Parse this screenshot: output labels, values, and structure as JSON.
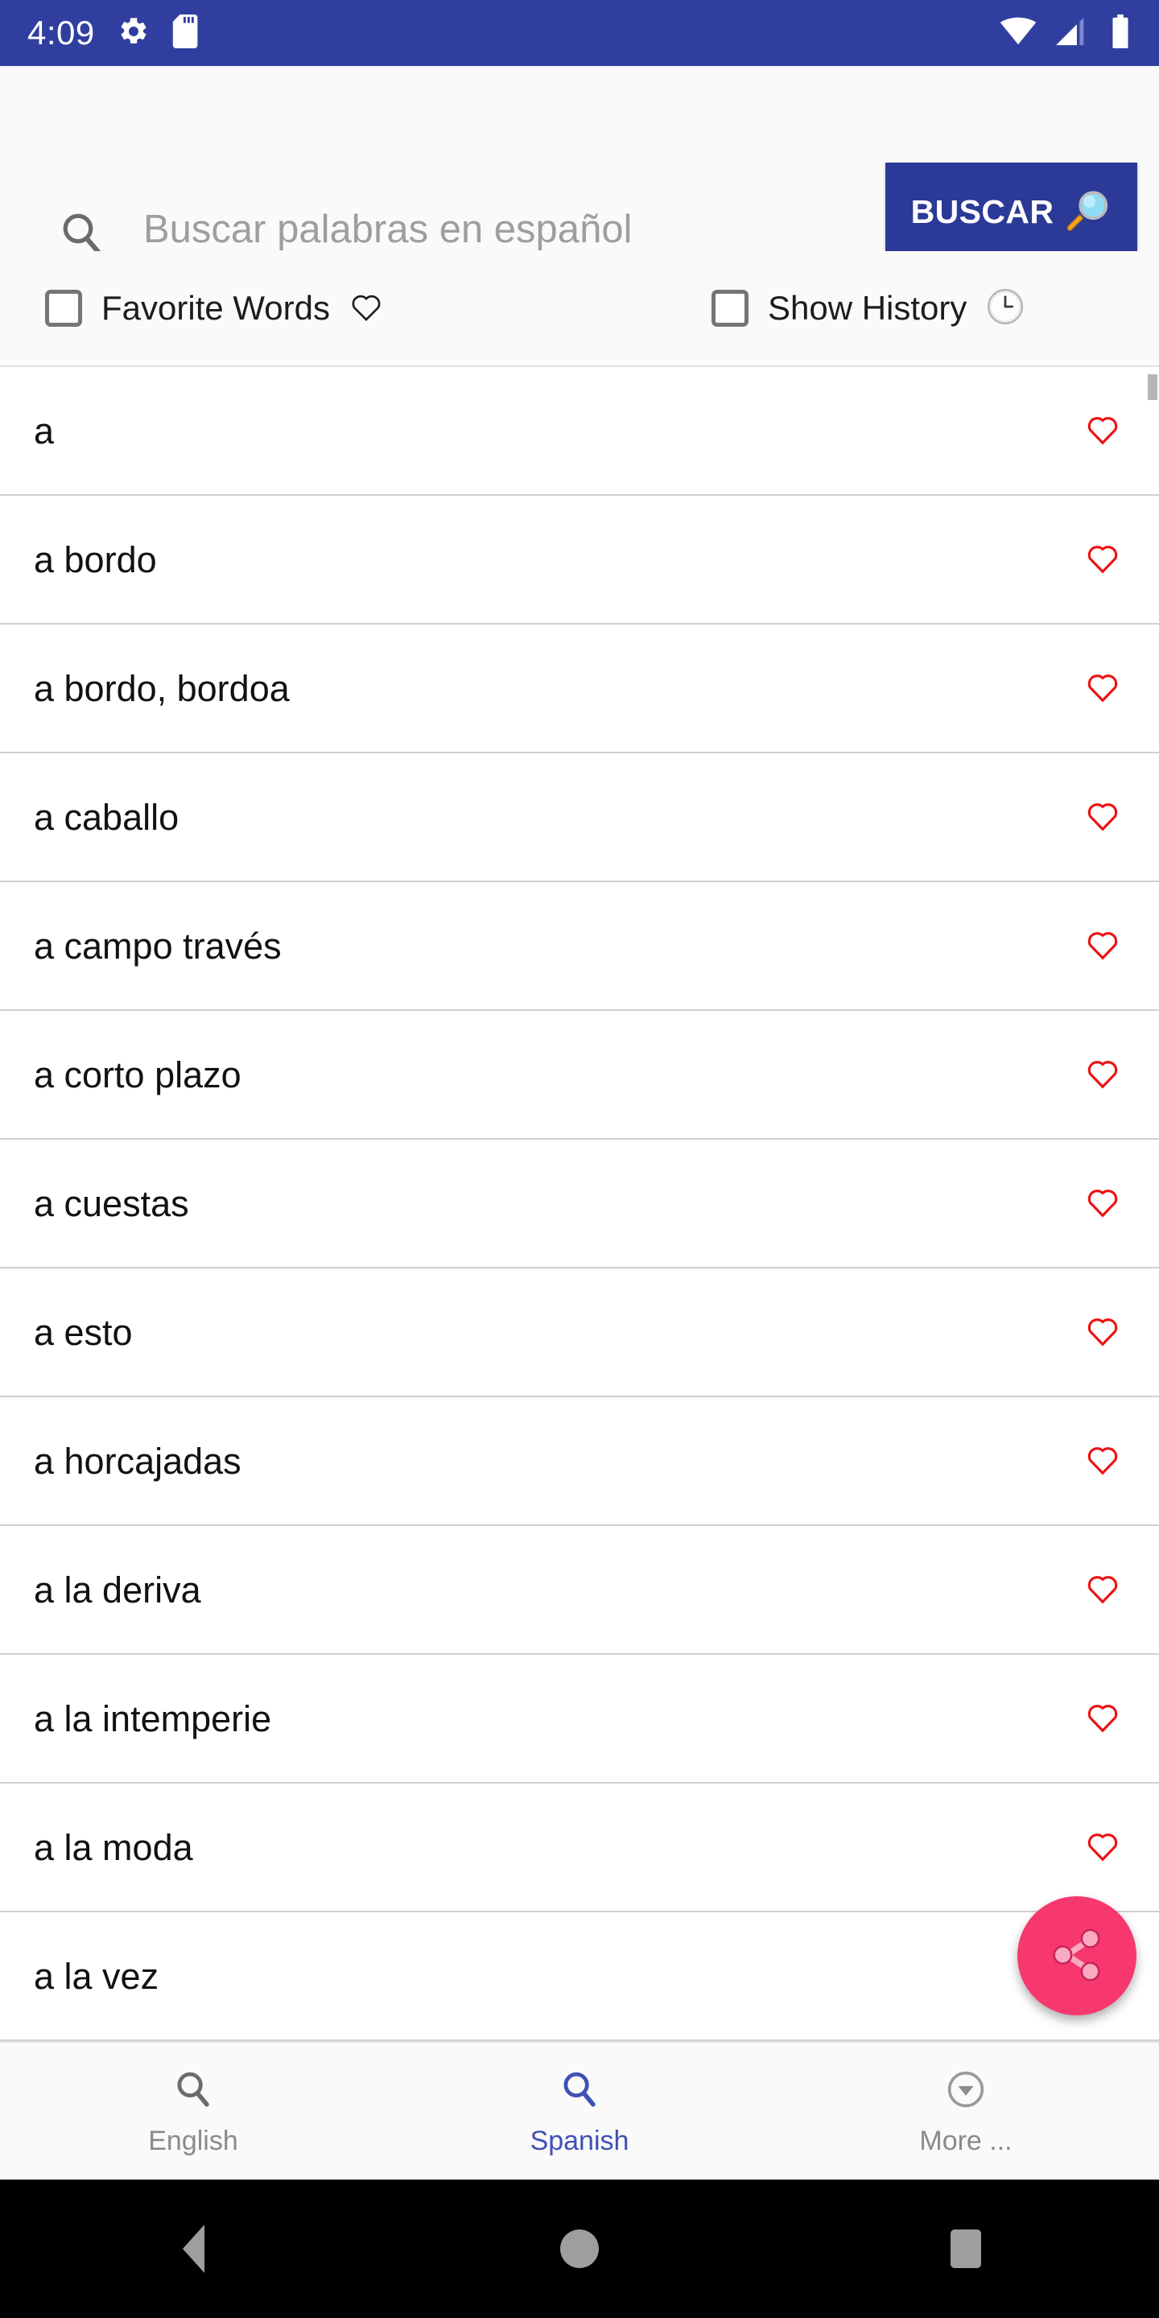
{
  "status_bar": {
    "time": "4:09",
    "left_icons": [
      "gear-icon",
      "sd-card-icon"
    ],
    "right_icons": [
      "wifi-icon",
      "cell-signal-icon",
      "battery-icon"
    ],
    "background_color": "#303f9f"
  },
  "search": {
    "icon": "search-icon",
    "value": "",
    "placeholder": "Buscar palabras en español",
    "button_label": "BUSCAR",
    "button_icon": "magnifying-glass-emoji",
    "button_color": "#2b3a96"
  },
  "options": [
    {
      "label": "Favorite Words",
      "glyph": "heart-outline-icon",
      "checked": false
    },
    {
      "label": "Show History",
      "glyph": "clock-icon",
      "checked": false
    }
  ],
  "word_list": {
    "favorite_icon": "heart-outline-icon",
    "favorite_color": "#ee1111",
    "items": [
      {
        "word": "a"
      },
      {
        "word": "a bordo"
      },
      {
        "word": "a bordo, bordoa"
      },
      {
        "word": "a caballo"
      },
      {
        "word": "a campo través"
      },
      {
        "word": "a corto plazo"
      },
      {
        "word": "a cuestas"
      },
      {
        "word": "a esto"
      },
      {
        "word": "a horcajadas"
      },
      {
        "word": "a la deriva"
      },
      {
        "word": "a la intemperie"
      },
      {
        "word": "a la moda"
      },
      {
        "word": "a la vez"
      }
    ]
  },
  "fab": {
    "icon": "share-icon",
    "color": "#f7386f"
  },
  "bottom_nav": {
    "accent_color": "#3f51b5",
    "inactive_color": "#8a8a8a",
    "tabs": [
      {
        "label": "English",
        "icon": "search-icon",
        "active": false
      },
      {
        "label": "Spanish",
        "icon": "search-icon",
        "active": true
      },
      {
        "label": "More ...",
        "icon": "chevron-down-circle-icon",
        "active": false
      }
    ]
  },
  "android_nav": {
    "buttons": [
      "back-triangle-icon",
      "home-circle-icon",
      "recents-square-icon"
    ]
  }
}
